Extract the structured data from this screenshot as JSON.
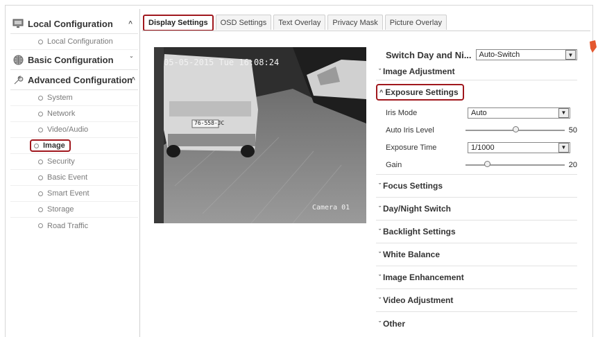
{
  "sidebar": {
    "local": {
      "label": "Local Configuration",
      "icon": "monitor-icon",
      "items": [
        "Local Configuration"
      ]
    },
    "basic": {
      "label": "Basic Configuration",
      "icon": "globe-icon"
    },
    "advanced": {
      "label": "Advanced Configuration",
      "icon": "wrench-icon",
      "items": [
        "System",
        "Network",
        "Video/Audio",
        "Image",
        "Security",
        "Basic Event",
        "Smart Event",
        "Storage",
        "Road Traffic"
      ],
      "active_item": "Image"
    }
  },
  "tabs": [
    "Display Settings",
    "OSD Settings",
    "Text Overlay",
    "Privacy Mask",
    "Picture Overlay"
  ],
  "active_tab": "Display Settings",
  "video": {
    "datetime": "05-05-2015 Tue 16:08:24",
    "camera_name": "Camera 01",
    "plate": "76-558-JC"
  },
  "settings": {
    "switch_label": "Switch Day and Ni...",
    "switch_value": "Auto-Switch",
    "image_adjustment": "Image Adjustment",
    "exposure": {
      "title": "Exposure Settings",
      "iris_mode_label": "Iris Mode",
      "iris_mode_value": "Auto",
      "auto_iris_label": "Auto Iris Level",
      "auto_iris_value": "50",
      "exposure_time_label": "Exposure Time",
      "exposure_time_value": "1/1000",
      "gain_label": "Gain",
      "gain_value": "20"
    },
    "sections": [
      "Focus Settings",
      "Day/Night Switch",
      "Backlight Settings",
      "White Balance",
      "Image Enhancement",
      "Video Adjustment",
      "Other"
    ]
  },
  "colors": {
    "highlight": "#a0171d",
    "accent": "#e4572e"
  }
}
